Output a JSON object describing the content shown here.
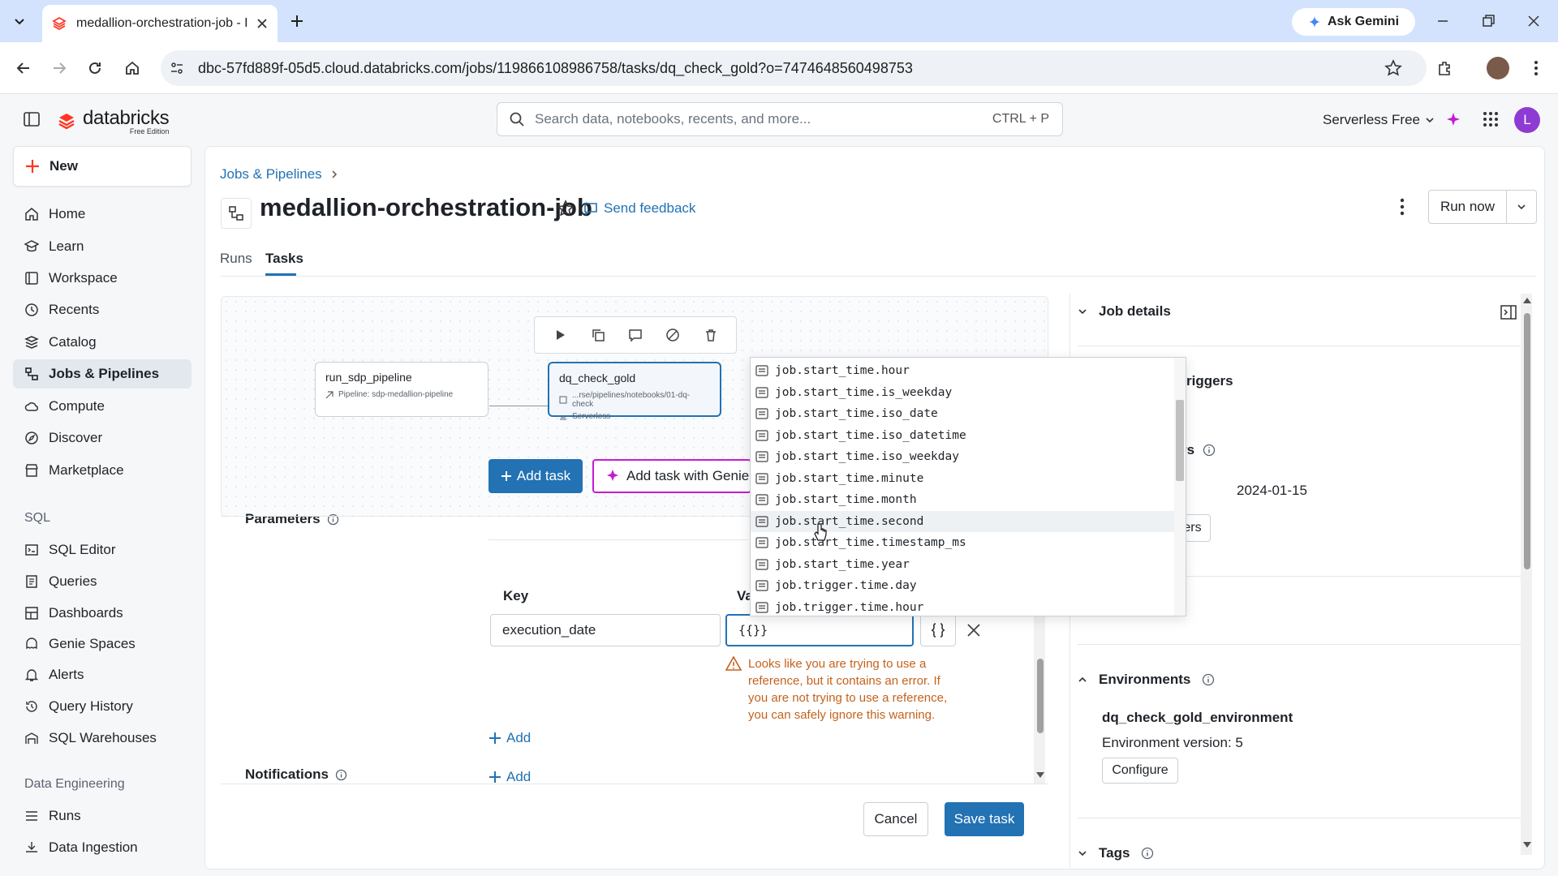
{
  "browser": {
    "tab_title": "medallion-orchestration-job - D",
    "ask_gemini": "Ask Gemini",
    "url": "dbc-57fd889f-05d5.cloud.databricks.com/jobs/119866108986758/tasks/dq_check_gold?o=7474648560498753"
  },
  "header": {
    "logo_text": "databricks",
    "logo_sub": "Free Edition",
    "search_placeholder": "Search data, notebooks, recents, and more...",
    "search_shortcut": "CTRL + P",
    "workspace": "Serverless Free",
    "avatar_letter": "L"
  },
  "sidebar": {
    "new_label": "New",
    "items": [
      {
        "label": "Home",
        "icon": "home-icon"
      },
      {
        "label": "Learn",
        "icon": "learn-icon"
      },
      {
        "label": "Workspace",
        "icon": "workspace-icon"
      },
      {
        "label": "Recents",
        "icon": "clock-icon"
      },
      {
        "label": "Catalog",
        "icon": "catalog-icon"
      },
      {
        "label": "Jobs & Pipelines",
        "icon": "jobs-icon"
      },
      {
        "label": "Compute",
        "icon": "cloud-icon"
      },
      {
        "label": "Discover",
        "icon": "compass-icon"
      },
      {
        "label": "Marketplace",
        "icon": "store-icon"
      }
    ],
    "sql_section": "SQL",
    "sql_items": [
      {
        "label": "SQL Editor"
      },
      {
        "label": "Queries"
      },
      {
        "label": "Dashboards"
      },
      {
        "label": "Genie Spaces"
      },
      {
        "label": "Alerts"
      },
      {
        "label": "Query History"
      },
      {
        "label": "SQL Warehouses"
      }
    ],
    "de_section": "Data Engineering",
    "de_items": [
      {
        "label": "Runs"
      },
      {
        "label": "Data Ingestion"
      }
    ]
  },
  "page": {
    "breadcrumb": "Jobs & Pipelines",
    "title": "medallion-orchestration-job",
    "send_feedback": "Send feedback",
    "run_now": "Run now",
    "tabs": [
      "Runs",
      "Tasks"
    ]
  },
  "dag": {
    "node1": {
      "name": "run_sdp_pipeline",
      "sub": "Pipeline:  sdp-medallion-pipeline"
    },
    "node2": {
      "name": "dq_check_gold",
      "sub1": "...rse/pipelines/notebooks/01-dq-check",
      "sub2": "Serverless"
    },
    "add_task": "Add task",
    "add_task_genie": "Add task with Genie C"
  },
  "form": {
    "parameters_label": "Parameters",
    "key_header": "Key",
    "value_header": "Va",
    "key_value": "execution_date",
    "value_value": "{{}}",
    "warning": "Looks like you are trying to use a reference, but it contains an error. If you are not trying to use a reference, you can safely ignore this warning.",
    "add": "Add",
    "notifications_label": "Notifications",
    "cancel": "Cancel",
    "save": "Save task"
  },
  "autocomplete": [
    "job.start_time.hour",
    "job.start_time.is_weekday",
    "job.start_time.iso_date",
    "job.start_time.iso_datetime",
    "job.start_time.iso_weekday",
    "job.start_time.minute",
    "job.start_time.month",
    "job.start_time.second",
    "job.start_time.timestamp_ms",
    "job.start_time.year",
    "job.trigger.time.day",
    "job.trigger.time.hour"
  ],
  "right_panel": {
    "job_details": "Job details",
    "triggers_partial": "riggers",
    "params_partial": "rs",
    "date_value": "2024-01-15",
    "edit_partial": "ers",
    "environments": "Environments",
    "env_name": "dq_check_gold_environment",
    "env_version": "Environment version: 5",
    "configure": "Configure",
    "tags": "Tags"
  },
  "colors": {
    "accent": "#2272b4",
    "warning": "#c4621c",
    "brand": "#ff3621"
  }
}
